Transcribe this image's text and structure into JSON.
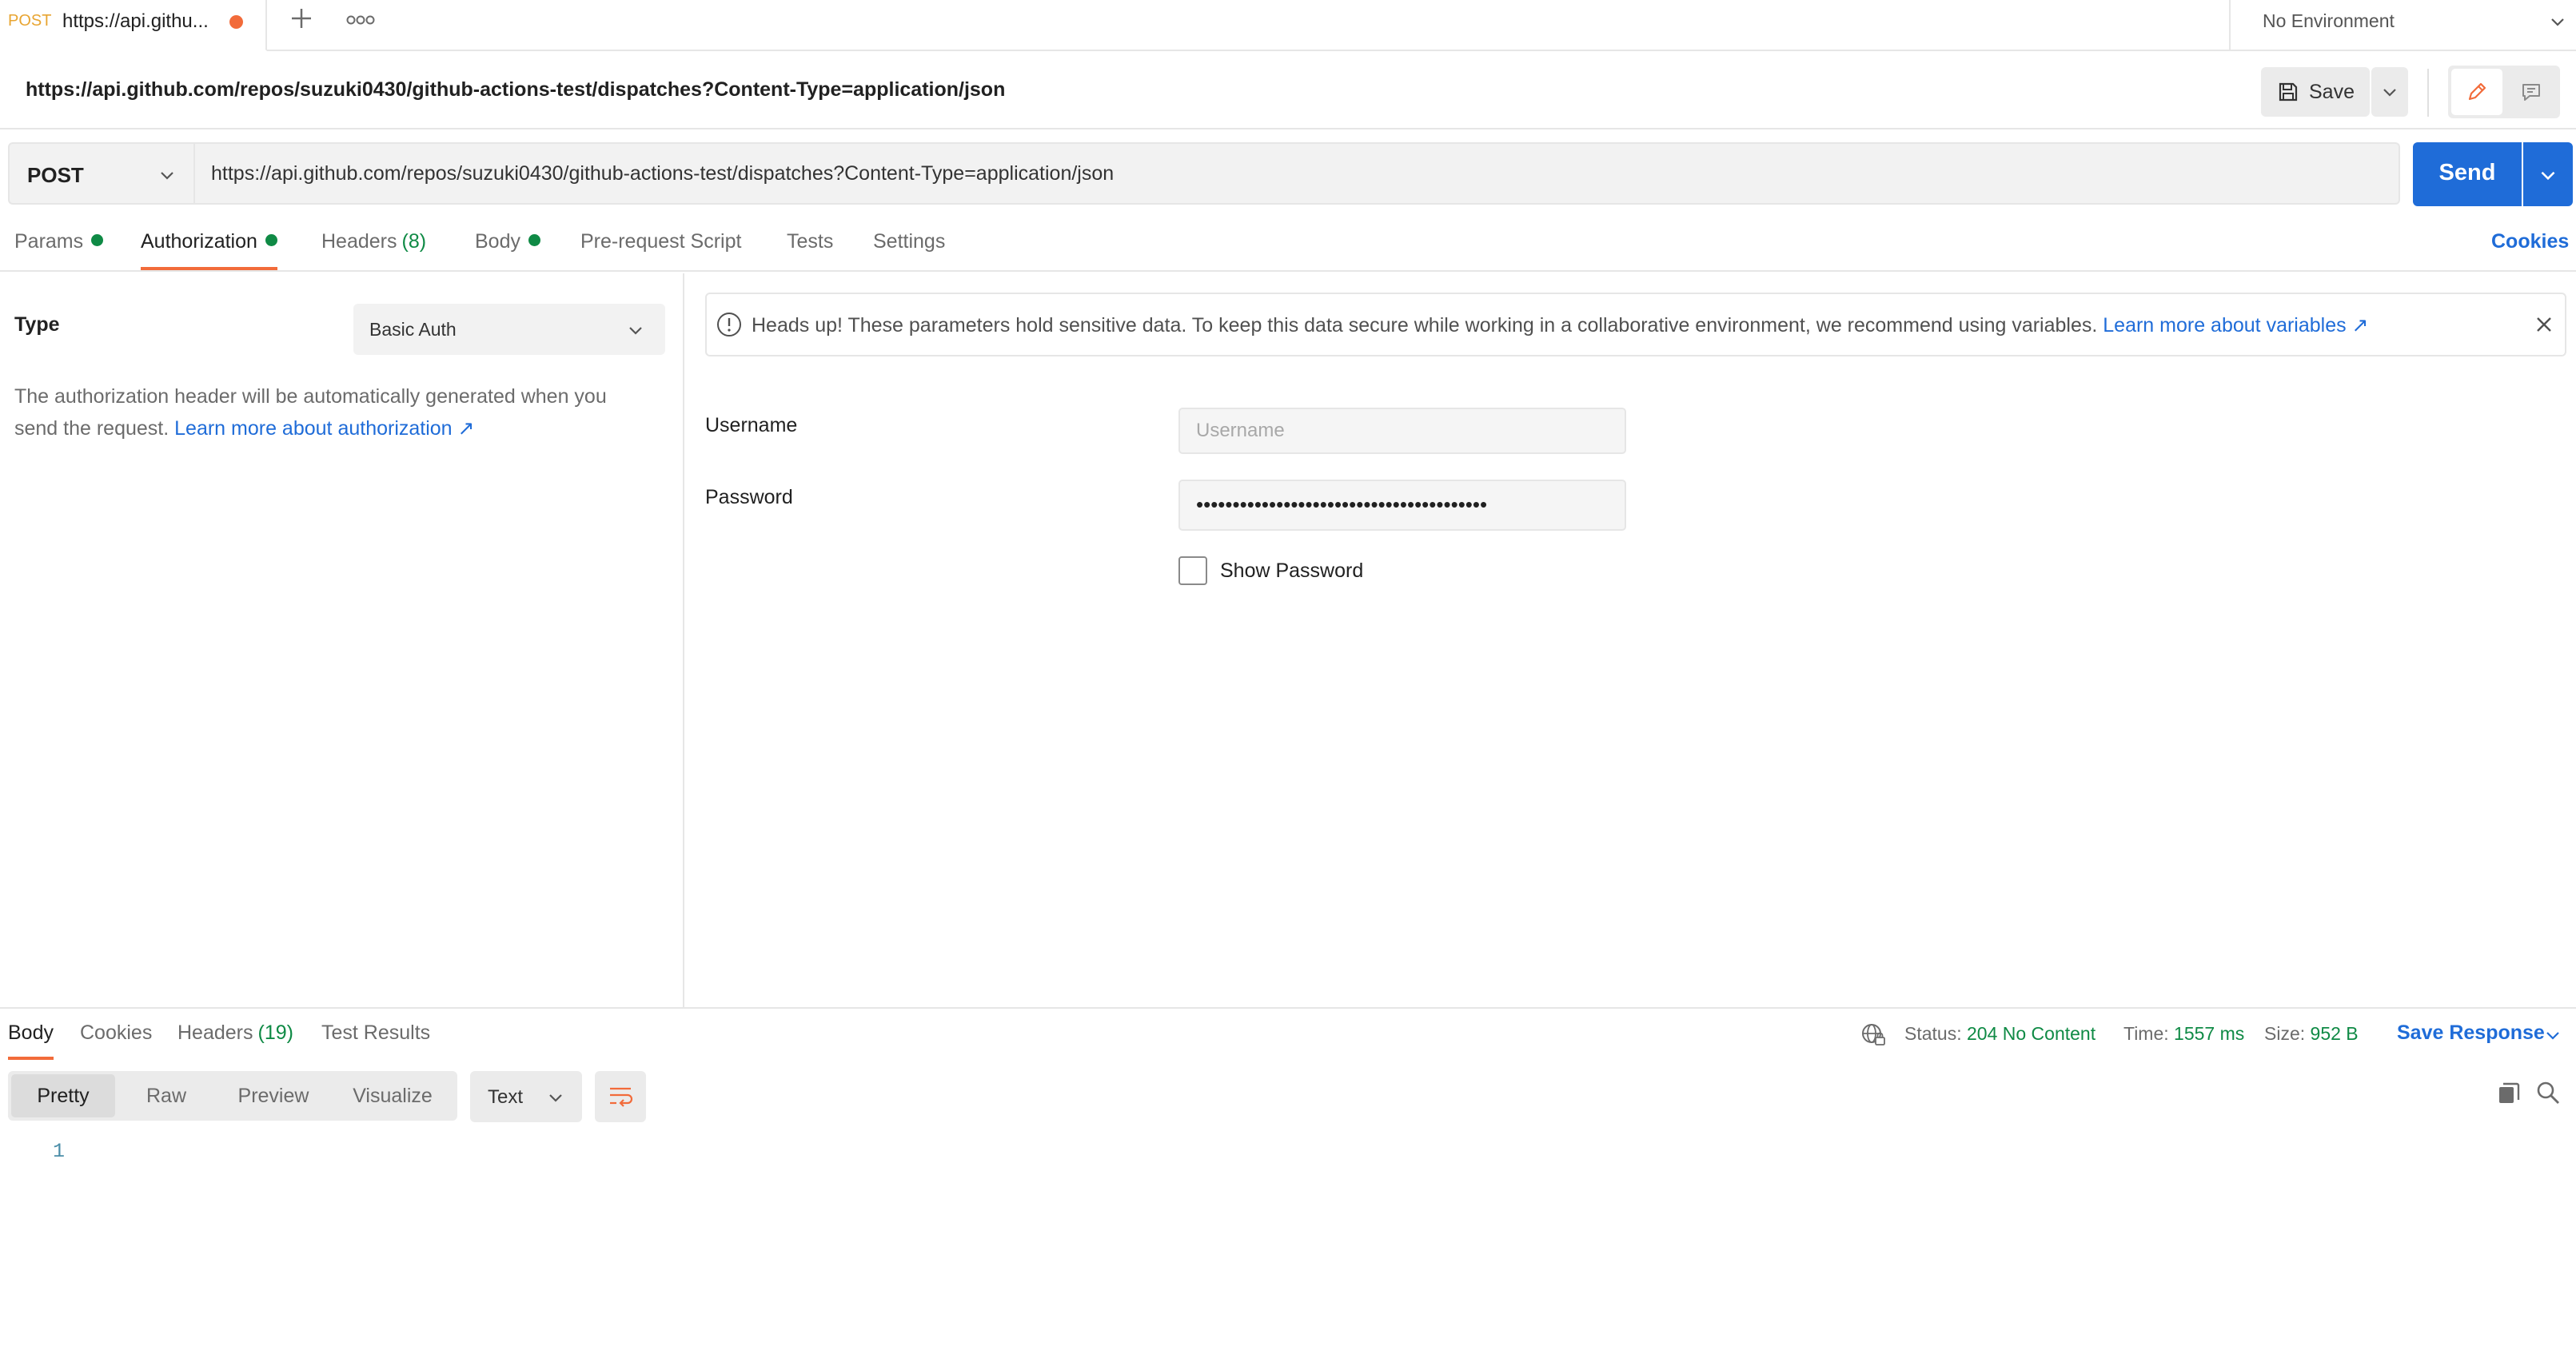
{
  "tab": {
    "method": "POST",
    "title": "https://api.githu...",
    "unsaved": true
  },
  "environment": {
    "label": "No Environment"
  },
  "request": {
    "name": "https://api.github.com/repos/suzuki0430/github-actions-test/dispatches?Content-Type=application/json",
    "method": "POST",
    "url": "https://api.github.com/repos/suzuki0430/github-actions-test/dispatches?Content-Type=application/json"
  },
  "toolbar": {
    "save_label": "Save",
    "send_label": "Send"
  },
  "request_tabs": [
    {
      "label": "Params",
      "dot": true
    },
    {
      "label": "Authorization",
      "dot": true,
      "active": true
    },
    {
      "label": "Headers",
      "count": "(8)"
    },
    {
      "label": "Body",
      "dot": true
    },
    {
      "label": "Pre-request Script"
    },
    {
      "label": "Tests"
    },
    {
      "label": "Settings"
    }
  ],
  "cookies_label": "Cookies",
  "auth": {
    "type_label": "Type",
    "type_value": "Basic Auth",
    "description": "The authorization header will be automatically generated when you send the request. ",
    "learn_more": "Learn more about authorization ↗",
    "alert_text": "Heads up! These parameters hold sensitive data. To keep this data secure while working in a collaborative environment, we recommend using variables. ",
    "alert_link": "Learn more about variables ↗",
    "username_label": "Username",
    "username_placeholder": "Username",
    "username_value": "",
    "password_label": "Password",
    "password_mask": "••••••••••••••••••••••••••••••••••••••••",
    "show_password_label": "Show Password",
    "show_password_checked": false
  },
  "response": {
    "tabs": [
      {
        "label": "Body",
        "active": true
      },
      {
        "label": "Cookies"
      },
      {
        "label": "Headers",
        "count": "(19)"
      },
      {
        "label": "Test Results"
      }
    ],
    "status_label": "Status:",
    "status_value": "204 No Content",
    "time_label": "Time:",
    "time_value": "1557 ms",
    "size_label": "Size:",
    "size_value": "952 B",
    "save_response_label": "Save Response",
    "view_modes": [
      "Pretty",
      "Raw",
      "Preview",
      "Visualize"
    ],
    "active_view": "Pretty",
    "format": "Text",
    "line_number": "1"
  },
  "colors": {
    "accent": "#f26b3a",
    "primary": "#1f6cd8",
    "success": "#0f8a45",
    "method_post": "#e8a532"
  }
}
